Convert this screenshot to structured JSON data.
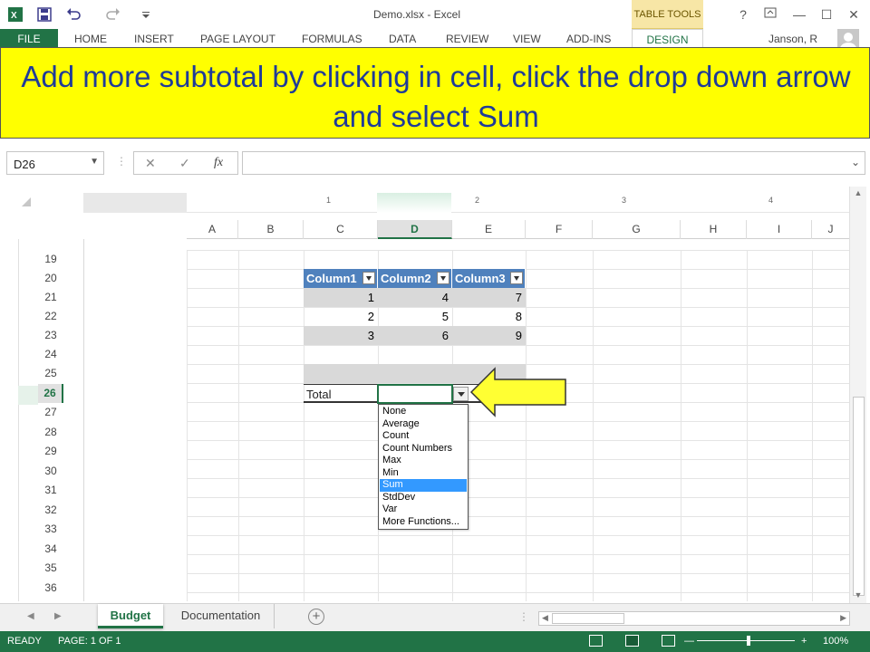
{
  "window": {
    "title": "Demo.xlsx - Excel",
    "table_tools": "TABLE TOOLS",
    "help": "?",
    "minimize": "—",
    "restore": "☐",
    "close": "✕"
  },
  "ribbon": {
    "file": "FILE",
    "tabs": [
      "HOME",
      "INSERT",
      "PAGE LAYOUT",
      "FORMULAS",
      "DATA",
      "REVIEW",
      "VIEW",
      "ADD-INS"
    ],
    "design": "DESIGN",
    "user": "Janson, R"
  },
  "banner": {
    "text": "Add more subtotal by clicking in cell, click the drop down arrow and select Sum"
  },
  "formula_bar": {
    "name_box": "D26",
    "cancel": "✕",
    "enter": "✓",
    "fx": "fx",
    "value": ""
  },
  "ruler": {
    "marks": [
      "1",
      "2",
      "3",
      "4"
    ]
  },
  "columns": [
    "A",
    "B",
    "C",
    "D",
    "E",
    "F",
    "G",
    "H",
    "I",
    "J"
  ],
  "active_column": "D",
  "rows": [
    "19",
    "20",
    "21",
    "22",
    "23",
    "24",
    "25",
    "26",
    "27",
    "28",
    "29",
    "30",
    "31",
    "32",
    "33",
    "34",
    "35",
    "36"
  ],
  "active_row": "26",
  "table": {
    "headers": [
      "Column1",
      "Column2",
      "Column3"
    ],
    "rows": [
      [
        "1",
        "4",
        "7"
      ],
      [
        "2",
        "5",
        "8"
      ],
      [
        "3",
        "6",
        "9"
      ]
    ],
    "total_label": "Total"
  },
  "dropdown": {
    "items": [
      "None",
      "Average",
      "Count",
      "Count Numbers",
      "Max",
      "Min",
      "Sum",
      "StdDev",
      "Var",
      "More Functions..."
    ],
    "selected": "Sum"
  },
  "sheets": {
    "tabs": [
      "Budget",
      "Documentation"
    ],
    "active": "Budget",
    "add": "+"
  },
  "status": {
    "ready": "READY",
    "page": "PAGE: 1 OF 1",
    "zoom": "100%",
    "zoom_minus": "—",
    "zoom_plus": "+"
  },
  "colors": {
    "excel_green": "#217346",
    "table_header": "#4f81bd",
    "banner_bg": "#ffff00",
    "banner_text": "#1f3b99",
    "arrow_fill": "#ffff33",
    "selection_blue": "#3399ff"
  }
}
